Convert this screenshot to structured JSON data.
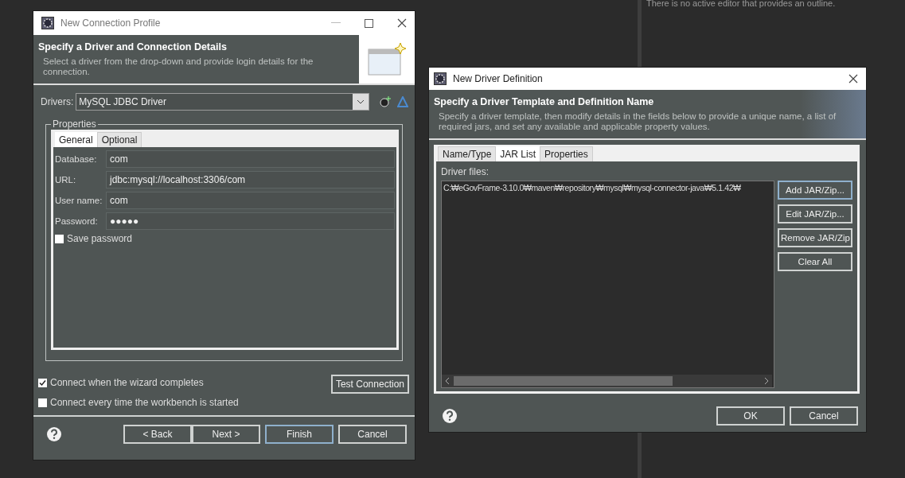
{
  "background_panel": {
    "text": "There is no active editor that provides an outline."
  },
  "connection_dialog": {
    "title": "New Connection Profile",
    "header": {
      "title": "Specify a Driver and Connection Details",
      "description": "Select a driver from the drop-down and provide login details for the connection."
    },
    "drivers": {
      "label": "Drivers:",
      "value": "MySQL JDBC Driver"
    },
    "properties": {
      "legend": "Properties",
      "tabs": [
        {
          "label": "General",
          "selected": true
        },
        {
          "label": "Optional",
          "selected": false
        }
      ],
      "fields": [
        {
          "label": "Database:",
          "value": "com"
        },
        {
          "label": "URL:",
          "value": "jdbc:mysql://localhost:3306/com"
        },
        {
          "label": "User name:",
          "value": "com"
        },
        {
          "label": "Password:",
          "value": "●●●●●"
        }
      ],
      "save_password": {
        "label": "Save password",
        "checked": false
      }
    },
    "options": [
      {
        "label": "Connect when the wizard completes",
        "checked": true
      },
      {
        "label": "Connect every time the workbench is started",
        "checked": false
      }
    ],
    "test_button": "Test Connection",
    "buttons": [
      {
        "label": "< Back",
        "default": false
      },
      {
        "label": "Next >",
        "default": false
      },
      {
        "label": "Finish",
        "default": true
      },
      {
        "label": "Cancel",
        "default": false
      }
    ]
  },
  "driver_dialog": {
    "title": "New Driver Definition",
    "header": {
      "title": "Specify a Driver Template and Definition Name",
      "description": "Specify a driver template, then modify details in the fields below to provide a unique name, a list of required jars, and set any available and applicable property values."
    },
    "tabs": [
      {
        "label": "Name/Type",
        "selected": false
      },
      {
        "label": "JAR List",
        "selected": true
      },
      {
        "label": "Properties",
        "selected": false
      }
    ],
    "driver_files": {
      "label": "Driver files:",
      "items": [
        "C:₩eGovFrame-3.10.0₩maven₩repository₩mysql₩mysql-connector-java₩5.1.42₩"
      ]
    },
    "side_buttons": [
      {
        "label": "Add JAR/Zip...",
        "focused": true
      },
      {
        "label": "Edit JAR/Zip...",
        "focused": false
      },
      {
        "label": "Remove JAR/Zip",
        "focused": false
      },
      {
        "label": "Clear All",
        "focused": false
      }
    ],
    "buttons": [
      {
        "label": "OK",
        "default": false
      },
      {
        "label": "Cancel",
        "default": false
      }
    ]
  }
}
